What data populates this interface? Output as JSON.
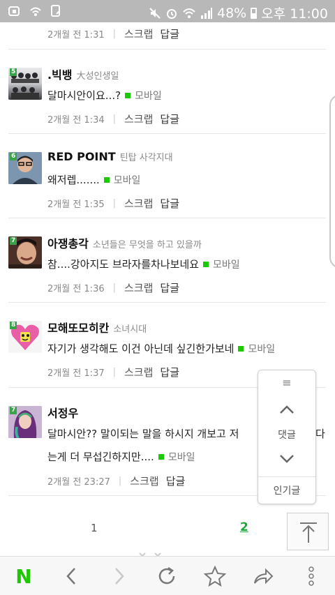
{
  "status_bar": {
    "battery": "48%",
    "time": "오후 11:00"
  },
  "top_partial": {
    "time": "2개월 전 1:31",
    "scrap": "스크랩",
    "reply": "답글"
  },
  "comments": [
    {
      "name": ".빅뱅",
      "group": "大성인생일",
      "text": "달마시안이요...?",
      "mobile": "모바일",
      "time": "2개월 전 1:34",
      "scrap": "스크랩",
      "reply": "답글",
      "badge": "5"
    },
    {
      "name": "RED POINT",
      "group": "틴탑 사각지대",
      "text": "왜저렙.......",
      "mobile": "모바일",
      "time": "2개월 전 1:35",
      "scrap": "스크랩",
      "reply": "답글",
      "badge": "6"
    },
    {
      "name": "아쟁총각",
      "group": "소년들은 무엇을 하고 있을까",
      "text": "참....강아지도 브라자를차나보네요",
      "mobile": "모바일",
      "time": "2개월 전 1:36",
      "scrap": "스크랩",
      "reply": "답글",
      "badge": "7"
    },
    {
      "name": "모해또모히칸",
      "group": "소녀시대",
      "text": "자기가 생각해도 이건 아닌데 싶긴한가보네",
      "mobile": "모바일",
      "time": "2개월 전 1:37",
      "scrap": "스크랩",
      "reply": "답글",
      "badge": "8"
    },
    {
      "name": "서정우",
      "group": "",
      "text": "달마시안?? 말이되는 말을 하시지 개보고 저",
      "text_tail": "다",
      "text2": "는게 더 무섭긴하지만....",
      "mobile": "모바일",
      "time": "2개월 전 23:27",
      "scrap": "스크랩",
      "reply": "답글",
      "badge": "7"
    }
  ],
  "float_panel": {
    "comments_label": "댓글",
    "popular_label": "인기글"
  },
  "pager": {
    "page1": "1",
    "page2": "2"
  },
  "bottom_bar": {
    "logo": "N"
  },
  "colors": {
    "accent_green": "#1ec800",
    "page_active": "#1ea83a"
  }
}
